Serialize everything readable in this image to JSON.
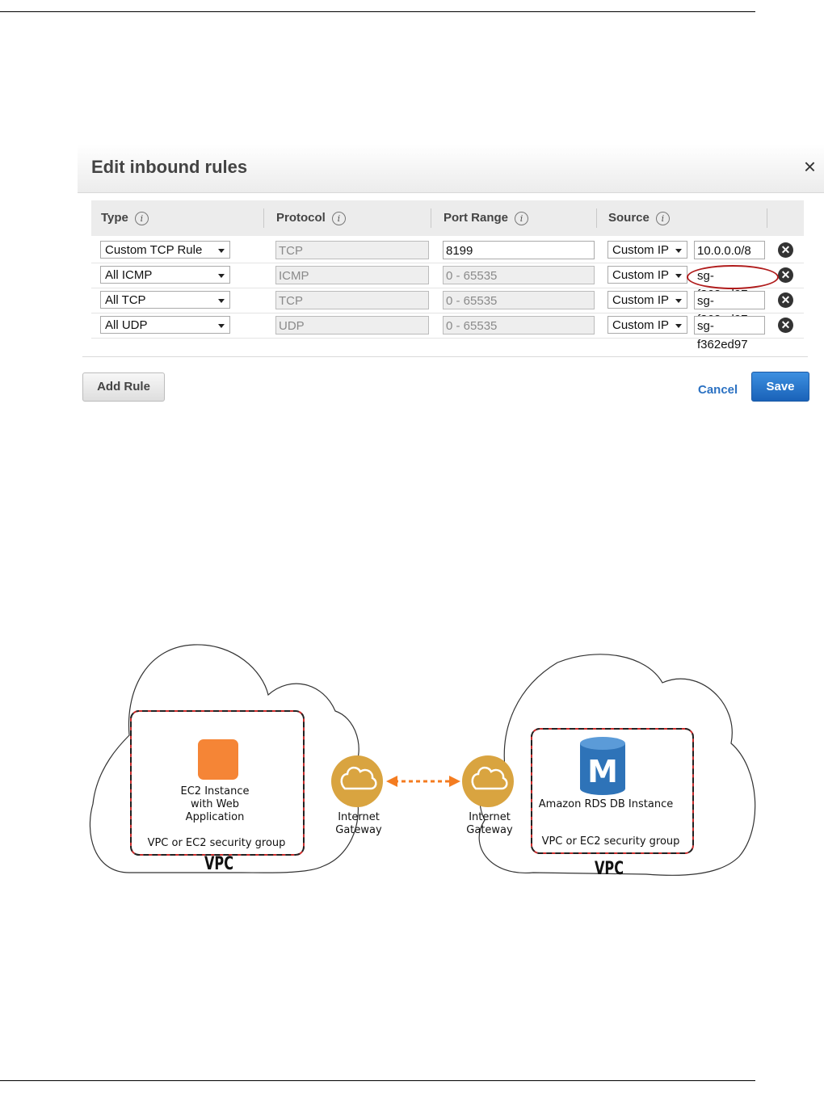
{
  "dialog": {
    "title": "Edit inbound rules",
    "close_glyph": "×",
    "columns": [
      "Type",
      "Protocol",
      "Port Range",
      "Source"
    ],
    "info_glyph": "i",
    "rows": [
      {
        "type": "Custom TCP Rule",
        "protocol": "TCP",
        "port_range": "8199",
        "source_type": "Custom IP",
        "source_value": "10.0.0.0/8"
      },
      {
        "type": "All ICMP",
        "protocol": "ICMP",
        "port_range": "0 - 65535",
        "source_type": "Custom IP",
        "source_value": "sg-f362ed97"
      },
      {
        "type": "All TCP",
        "protocol": "TCP",
        "port_range": "0 - 65535",
        "source_type": "Custom IP",
        "source_value": "sg-f362ed97"
      },
      {
        "type": "All UDP",
        "protocol": "UDP",
        "port_range": "0 - 65535",
        "source_type": "Custom IP",
        "source_value": "sg-f362ed97"
      }
    ],
    "delete_glyph": "✕",
    "add_rule_label": "Add Rule",
    "cancel_label": "Cancel",
    "save_label": "Save",
    "highlight_color": "#b01c1c"
  },
  "diagram": {
    "left_vpc": {
      "instance_line1": "EC2 Instance",
      "instance_line2": "with Web",
      "instance_line3": "Application",
      "security_group": "VPC or EC2 security group",
      "vpc_label": "VPC",
      "gateway_line1": "Internet",
      "gateway_line2": "Gateway"
    },
    "right_vpc": {
      "db_label": "Amazon RDS DB Instance",
      "db_icon_letter": "M",
      "security_group": "VPC or EC2 security group",
      "vpc_label": "VPC",
      "gateway_line1": "Internet",
      "gateway_line2": "Gateway"
    },
    "colors": {
      "ec2": "#f58536",
      "gateway": "#d9a440",
      "rds": "#2e73b8",
      "arrow": "#f47c20",
      "group_border": "#cc2a2a"
    }
  }
}
